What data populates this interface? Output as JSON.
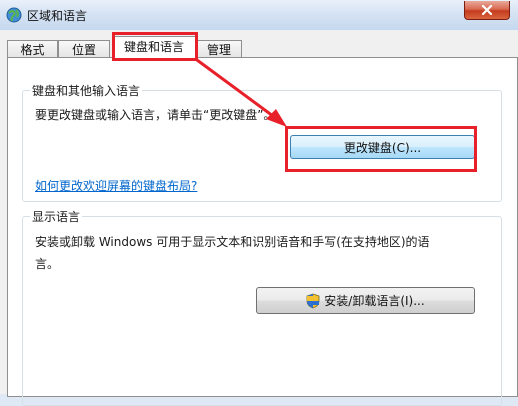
{
  "window": {
    "title": "区域和语言"
  },
  "tabs": [
    {
      "label": "格式"
    },
    {
      "label": "位置"
    },
    {
      "label": "键盘和语言"
    },
    {
      "label": "管理"
    }
  ],
  "keyboard_group": {
    "title": "键盘和其他输入语言",
    "description": "要更改键盘或输入语言，请单击“更改键盘”。",
    "change_keyboard_button": "更改键盘(C)...",
    "welcome_link": "如何更改欢迎屏幕的键盘布局?"
  },
  "display_group": {
    "title": "显示语言",
    "description_line1": "安装或卸载 Windows 可用于显示文本和识别语音和手写(在支持地区)的语",
    "description_line2": "言。",
    "install_button": "安装/卸载语言(I)..."
  },
  "colors": {
    "highlight_red": "#e8202a",
    "link_blue": "#0066cc"
  },
  "icons": {
    "window": "globe-icon",
    "close": "close-icon",
    "install": "shield-icon"
  }
}
